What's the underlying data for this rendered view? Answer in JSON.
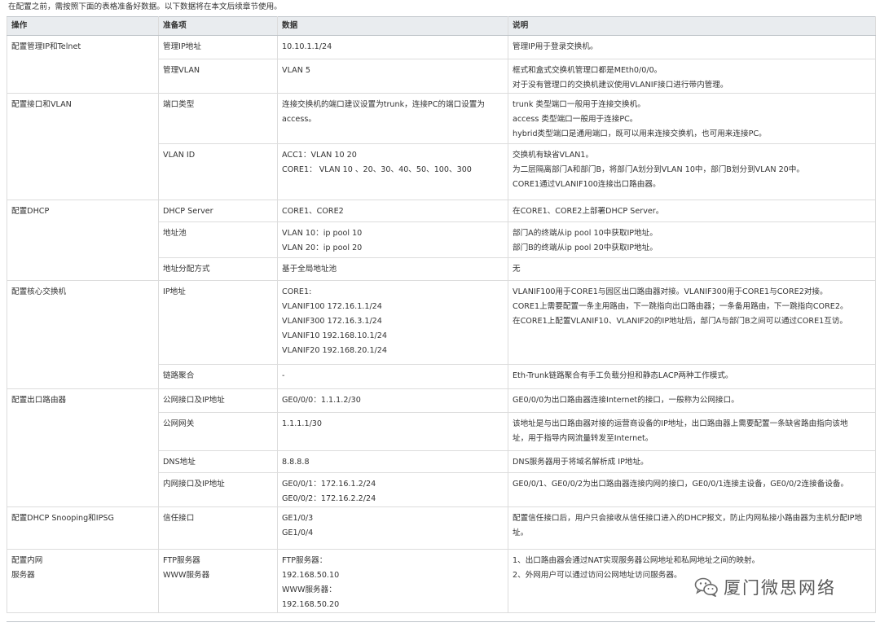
{
  "intro": "在配置之前，需按照下面的表格准备好数据。以下数据将在本文后续章节使用。",
  "headers": [
    "操作",
    "准备项",
    "数据",
    "说明"
  ],
  "groups": [
    {
      "op": [
        "配置管理IP和Telnet"
      ],
      "rows": [
        {
          "item": [
            "管理IP地址"
          ],
          "data": [
            "10.10.1.1/24"
          ],
          "desc": [
            "管理IP用于登录交换机。"
          ]
        },
        {
          "item": [
            "管理VLAN"
          ],
          "data": [
            "VLAN 5"
          ],
          "desc": [
            "框式和盒式交换机管理口都是MEth0/0/0。",
            "对于没有管理口的交换机建议使用VLANIF接口进行带内管理。"
          ]
        }
      ]
    },
    {
      "op": [
        "配置接口和VLAN"
      ],
      "rows": [
        {
          "item": [
            "端口类型"
          ],
          "data": [
            "连接交换机的端口建议设置为trunk，连接PC的端口设置为",
            "access。"
          ],
          "desc": [
            "trunk 类型端口一般用于连接交换机。",
            "access 类型端口一般用于连接PC。",
            "hybrid类型端口是通用端口，既可以用来连接交换机，也可用来连接PC。"
          ]
        },
        {
          "item": [
            "VLAN ID"
          ],
          "data": [
            "ACC1：VLAN 10 20",
            "CORE1： VLAN 10 、20、30、40、50、100、300"
          ],
          "desc": [
            "交换机有缺省VLAN1。",
            "为二层隔离部门A和部门B，将部门A划分到VLAN 10中，部门B划分到VLAN 20中。",
            "CORE1通过VLANIF100连接出口路由器。"
          ]
        }
      ]
    },
    {
      "op": [
        "配置DHCP"
      ],
      "rows": [
        {
          "item": [
            "DHCP Server"
          ],
          "data": [
            "CORE1、CORE2"
          ],
          "desc": [
            "在CORE1、CORE2上部署DHCP Server。"
          ]
        },
        {
          "item": [
            "地址池"
          ],
          "data": [
            "VLAN 10：ip pool 10",
            "VLAN 20：ip pool 20"
          ],
          "desc": [
            "部门A的终端从ip pool 10中获取IP地址。",
            "部门B的终端从ip pool 20中获取IP地址。"
          ]
        },
        {
          "item": [
            "地址分配方式"
          ],
          "data": [
            "基于全局地址池"
          ],
          "desc": [
            "无"
          ]
        }
      ]
    },
    {
      "op": [
        "配置核心交换机"
      ],
      "rows": [
        {
          "item": [
            "IP地址"
          ],
          "data": [
            "CORE1:",
            "VLANIF100 172.16.1.1/24",
            "VLANIF300 172.16.3.1/24",
            "VLANIF10 192.168.10.1/24",
            "VLANIF20 192.168.20.1/24"
          ],
          "desc": [
            "VLANIF100用于CORE1与园区出口路由器对接。VLANIF300用于CORE1与CORE2对接。",
            "CORE1上需要配置一条主用路由，下一跳指向出口路由器；一条备用路由，下一跳指向CORE2。",
            "在CORE1上配置VLANIF10、VLANIF20的IP地址后，部门A与部门B之间可以通过CORE1互访。"
          ]
        },
        {
          "item": [
            "链路聚合"
          ],
          "data": [
            "-"
          ],
          "desc": [
            "Eth-Trunk链路聚合有手工负载分担和静态LACP两种工作模式。"
          ]
        }
      ]
    },
    {
      "op": [
        "配置出口路由器"
      ],
      "rows": [
        {
          "item": [
            "公网接口及IP地址"
          ],
          "data": [
            "GE0/0/0：1.1.1.2/30"
          ],
          "desc": [
            "GE0/0/0为出口路由器连接Internet的接口，一般称为公网接口。"
          ]
        },
        {
          "item": [
            "公网网关"
          ],
          "data": [
            "1.1.1.1/30"
          ],
          "desc": [
            "该地址是与出口路由器对接的运营商设备的IP地址，出口路由器上需要配置一条缺省路由指向该地",
            "址，用于指导内网流量转发至Internet。"
          ]
        },
        {
          "item": [
            "DNS地址"
          ],
          "data": [
            "8.8.8.8"
          ],
          "desc": [
            "DNS服务器用于将域名解析成 IP地址。"
          ]
        },
        {
          "item": [
            "内网接口及IP地址"
          ],
          "data": [
            "GE0/0/1：172.16.1.2/24",
            "GE0/0/2：172.16.2.2/24"
          ],
          "desc": [
            "GE0/0/1、GE0/0/2为出口路由器连接内网的接口，GE0/0/1连接主设备，GE0/0/2连接备设备。"
          ]
        }
      ]
    },
    {
      "op": [
        "配置DHCP Snooping和IPSG"
      ],
      "rows": [
        {
          "item": [
            "信任接口"
          ],
          "data": [
            "GE1/0/3",
            "GE1/0/4"
          ],
          "desc": [
            "配置信任接口后，用户只会接收从信任接口进入的DHCP报文，防止内网私接小路由器为主机分配IP地",
            "址。"
          ]
        }
      ]
    },
    {
      "op": [
        "配置内网",
        "服务器"
      ],
      "rows": [
        {
          "item": [
            "FTP服务器",
            "WWW服务器"
          ],
          "data": [
            "FTP服务器：",
            "192.168.50.10",
            "WWW服务器：",
            "192.168.50.20"
          ],
          "desc": [
            "1、出口路由器会通过NAT实现服务器公网地址和私网地址之间的映射。",
            "2、外网用户可以通过访问公网地址访问服务器。"
          ]
        }
      ]
    }
  ],
  "watermark": {
    "text": "厦门微思网络",
    "icon": "wechat-icon",
    "color": "#5a5a5a"
  }
}
